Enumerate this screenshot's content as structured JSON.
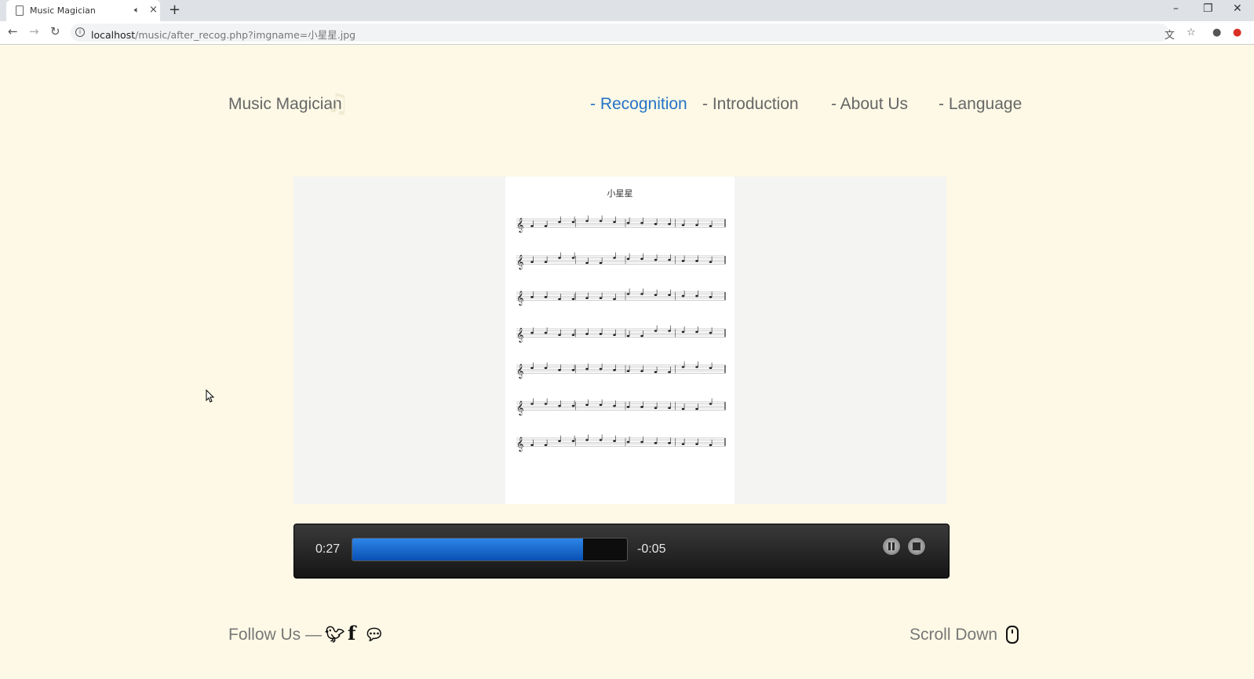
{
  "browser": {
    "tab_title": "Music Magician",
    "tab_audio_icon": "speaker-icon",
    "tab_close": "×",
    "new_tab": "+",
    "url_host": "localhost",
    "url_path": "/music/after_recog.php?imgname=小星星.jpg",
    "window_controls": [
      "–",
      "❐",
      "✕"
    ]
  },
  "header": {
    "brand": "Music Magician",
    "nav": [
      {
        "label": "- Recognition",
        "active": true
      },
      {
        "label": "- Introduction",
        "active": false
      },
      {
        "label": "- About Us",
        "active": false
      },
      {
        "label": "- Language",
        "active": false
      }
    ]
  },
  "score": {
    "title": "小星星",
    "staff_count": 7
  },
  "player": {
    "current_time": "0:27",
    "remaining_time": "-0:05",
    "progress": 0.84,
    "pause_icon": "pause-icon",
    "stop_icon": "stop-icon",
    "accent": "#1565d8"
  },
  "footer": {
    "follow_label": "Follow Us —",
    "social_icons": [
      "twitter-icon",
      "facebook-icon",
      "wechat-icon"
    ],
    "scroll_label": "Scroll Down",
    "scroll_icon": "mouse-icon"
  }
}
